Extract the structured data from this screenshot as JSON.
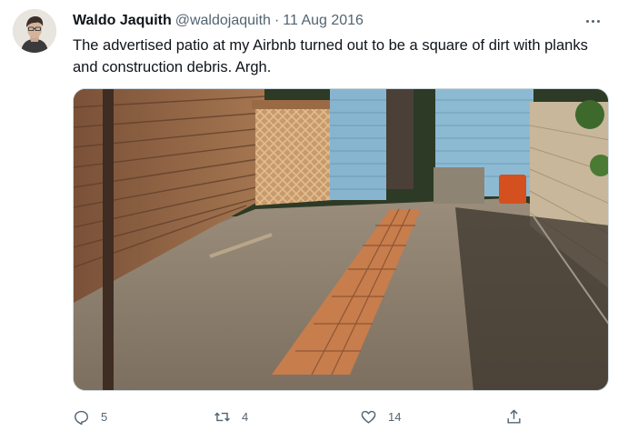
{
  "author": {
    "display_name": "Waldo Jaquith",
    "handle": "@waldojaquith",
    "separator": "·",
    "date": "11 Aug 2016"
  },
  "tweet": {
    "text": "The advertised patio at my Airbnb turned out to be a square of dirt with planks and construction debris. Argh."
  },
  "media": {
    "description_icon": "photo-of-dirt-patio"
  },
  "actions": {
    "reply": {
      "icon": "reply-icon",
      "count": "5"
    },
    "retweet": {
      "icon": "retweet-icon",
      "count": "4"
    },
    "like": {
      "icon": "heart-icon",
      "count": "14"
    },
    "share": {
      "icon": "share-icon"
    }
  },
  "colors": {
    "text_primary": "#0f1419",
    "text_secondary": "#536471",
    "border": "#cfd9de"
  }
}
